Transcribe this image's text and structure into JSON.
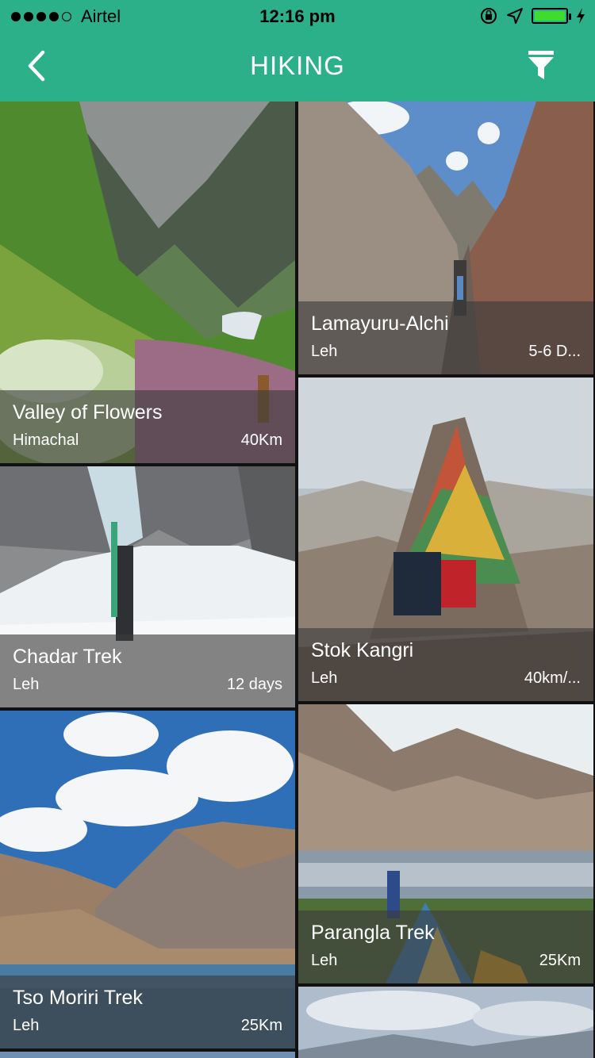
{
  "status_bar": {
    "carrier": "Airtel",
    "time": "12:16 pm"
  },
  "header": {
    "title": "HIKING"
  },
  "icons": {
    "back": "chevron-left-icon",
    "filter": "filter-funnel-icon",
    "signal": "signal-dots-icon",
    "rotation_lock": "rotation-lock-icon",
    "location": "location-arrow-icon",
    "battery": "battery-icon",
    "charging": "charging-bolt-icon"
  },
  "colors": {
    "accent": "#2bb08a",
    "battery_fill": "#3ddc2f",
    "overlay": "rgba(60,60,60,0.62)"
  },
  "treks": [
    {
      "name": "Valley of Flowers",
      "location": "Himachal",
      "distance": "40Km"
    },
    {
      "name": "Lamayuru-Alchi",
      "location": "Leh",
      "distance": "5-6 D..."
    },
    {
      "name": "Chadar Trek",
      "location": "Leh",
      "distance": "12 days"
    },
    {
      "name": "Stok Kangri",
      "location": "Leh",
      "distance": "40km/..."
    },
    {
      "name": "Tso Moriri Trek",
      "location": "Leh",
      "distance": "25Km"
    },
    {
      "name": "Parangla Trek",
      "location": "Leh",
      "distance": "25Km"
    }
  ]
}
